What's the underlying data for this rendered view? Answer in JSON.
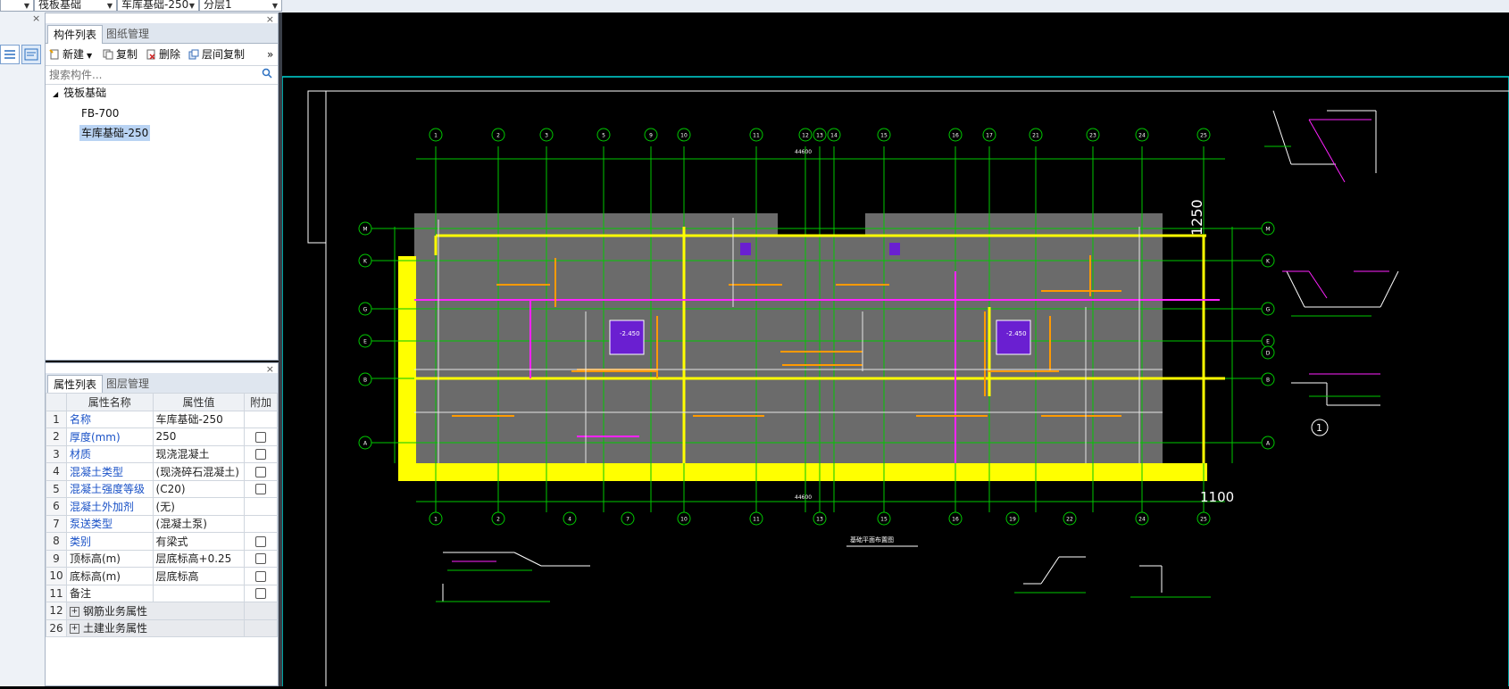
{
  "toolbar": {
    "dropdowns": [
      {
        "value": ""
      },
      {
        "value": "筏板基础"
      },
      {
        "value": "车库基础-250"
      },
      {
        "value": "分层1"
      }
    ]
  },
  "component_panel": {
    "tabs": [
      "构件列表",
      "图纸管理"
    ],
    "actions": {
      "new": "新建",
      "copy": "复制",
      "delete": "删除",
      "floor_copy": "层间复制",
      "more": "»"
    },
    "search_placeholder": "搜索构件...",
    "tree": {
      "group": "筏板基础",
      "items": [
        "FB-700",
        "车库基础-250"
      ],
      "selected": "车库基础-250"
    }
  },
  "property_panel": {
    "tabs": [
      "属性列表",
      "图层管理"
    ],
    "headers": [
      "属性名称",
      "属性值",
      "附加"
    ],
    "rows": [
      {
        "idx": "1",
        "name": "名称",
        "value": "车库基础-250",
        "blue": true,
        "cb": false
      },
      {
        "idx": "2",
        "name": "厚度(mm)",
        "value": "250",
        "blue": true,
        "cb": true
      },
      {
        "idx": "3",
        "name": "材质",
        "value": "现浇混凝土",
        "blue": true,
        "cb": true
      },
      {
        "idx": "4",
        "name": "混凝土类型",
        "value": "(现浇碎石混凝土)",
        "blue": true,
        "cb": true
      },
      {
        "idx": "5",
        "name": "混凝土强度等级",
        "value": "(C20)",
        "blue": true,
        "cb": true
      },
      {
        "idx": "6",
        "name": "混凝土外加剂",
        "value": "(无)",
        "blue": true,
        "cb": false
      },
      {
        "idx": "7",
        "name": "泵送类型",
        "value": "(混凝土泵)",
        "blue": true,
        "cb": false
      },
      {
        "idx": "8",
        "name": "类别",
        "value": "有梁式",
        "blue": true,
        "cb": true
      },
      {
        "idx": "9",
        "name": "顶标高(m)",
        "value": "层底标高+0.25",
        "blue": false,
        "cb": true
      },
      {
        "idx": "10",
        "name": "底标高(m)",
        "value": "层底标高",
        "blue": false,
        "cb": true
      },
      {
        "idx": "11",
        "name": "备注",
        "value": "",
        "blue": false,
        "cb": true
      },
      {
        "idx": "12",
        "name": "钢筋业务属性",
        "value": "",
        "group": true
      },
      {
        "idx": "26",
        "name": "土建业务属性",
        "value": "",
        "group": true
      }
    ]
  },
  "drawing": {
    "top_axes": [
      "1",
      "2",
      "3",
      "5",
      "9",
      "10",
      "11",
      "12",
      "13",
      "14",
      "15",
      "16",
      "17",
      "21",
      "23",
      "24",
      "25"
    ],
    "bottom_axes": [
      "1",
      "2",
      "4",
      "7",
      "10",
      "11",
      "13",
      "15",
      "16",
      "19",
      "22",
      "24",
      "25"
    ],
    "left_axes": [
      "M",
      "K",
      "G",
      "E",
      "B",
      "A"
    ],
    "right_axes": [
      "M",
      "K",
      "G",
      "E",
      "D",
      "B",
      "A"
    ],
    "overall_dim": "44600",
    "label_1250": "1250",
    "label_1100": "1100",
    "section_mark": "1",
    "elevation_tags": [
      "-2.450",
      "-2.450"
    ],
    "plan_title": "基础平面布置图",
    "colors": {
      "slab": "#6b6b6b",
      "grid": "#00c800",
      "yellow": "#ffff00",
      "magenta": "#ff22ff",
      "orange": "#ff9a00",
      "pit": "#6a1fd1",
      "frame": "#00d8d8"
    }
  }
}
